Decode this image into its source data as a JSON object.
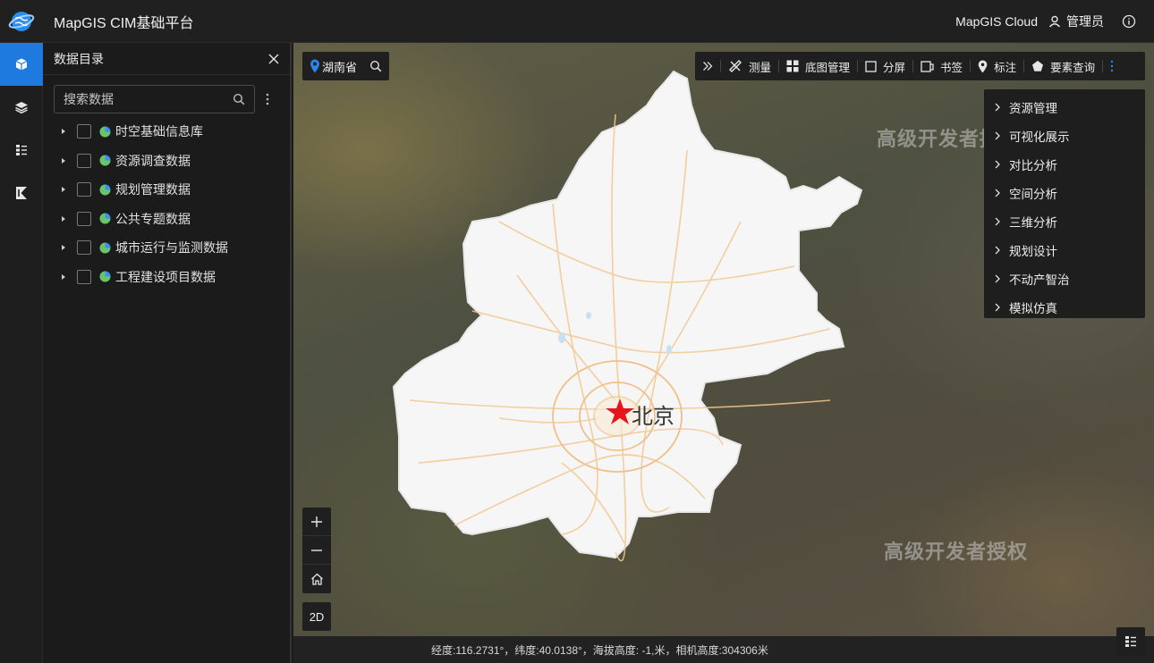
{
  "app": {
    "title": "MapGIS CIM基础平台",
    "cloud_link": "MapGIS Cloud",
    "user_name": "管理员"
  },
  "colors": {
    "accent": "#1f7ae0",
    "header_bg": "#202020",
    "panel_bg": "#1b1b1b",
    "pie_green": "#6ac46a",
    "pie_blue": "#3d8ef0",
    "marker_red": "#e8141c"
  },
  "rail": {
    "items": [
      {
        "icon": "cube-icon",
        "active": true
      },
      {
        "icon": "layers-icon",
        "active": false
      },
      {
        "icon": "list-icon",
        "active": false
      },
      {
        "icon": "k-flag-icon",
        "active": false
      }
    ]
  },
  "panel": {
    "title": "数据目录",
    "search_placeholder": "搜索数据",
    "tree": [
      {
        "label": "时空基础信息库"
      },
      {
        "label": "资源调查数据"
      },
      {
        "label": "规划管理数据"
      },
      {
        "label": "公共专题数据"
      },
      {
        "label": "城市运行与监测数据"
      },
      {
        "label": "工程建设项目数据"
      }
    ]
  },
  "map": {
    "location": "湖南省",
    "city_label": "北京",
    "watermark": "高级开发者授权",
    "toolbar": {
      "measure": "测量",
      "basemap": "底图管理",
      "split": "分屏",
      "bookmark": "书签",
      "annotate": "标注",
      "feature_query": "要素查询"
    },
    "dropdown": [
      "资源管理",
      "可视化展示",
      "对比分析",
      "空间分析",
      "三维分析",
      "规划设计",
      "不动产智治",
      "模拟仿真"
    ],
    "mode_button": "2D",
    "status": "经度:116.2731°，纬度:40.0138°，海拔高度: -1,米，相机高度:304306米"
  }
}
